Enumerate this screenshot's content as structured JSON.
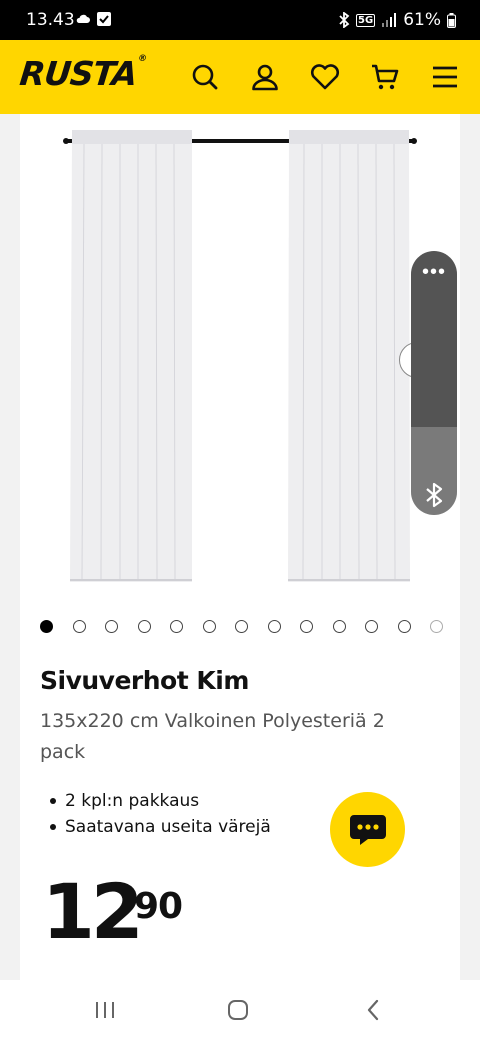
{
  "status_bar": {
    "time": "13.43",
    "battery": "61%",
    "network": "5G",
    "icons": [
      "cloud-icon",
      "check-box-icon",
      "bluetooth-icon",
      "signal-icon",
      "battery-icon"
    ]
  },
  "header": {
    "logo": "RUSTA",
    "logo_mark": "®",
    "background": "#ffd600",
    "icons": [
      "search-icon",
      "user-icon",
      "heart-icon",
      "cart-icon",
      "menu-icon"
    ]
  },
  "gallery": {
    "image": "curtain-pair-image",
    "dot_count": 13,
    "active_index": 0
  },
  "product": {
    "title": "Sivuverhot Kim",
    "subtitle": "135x220 cm Valkoinen Polyesteriä 2 pack",
    "features": [
      "2 kpl:n pakkaus",
      "Saatavana useita värejä"
    ],
    "price_int": "12",
    "price_dec": "90"
  },
  "chat": {
    "icon": "chat-icon"
  },
  "side_panel": {
    "icons": [
      "more-icon",
      "bluetooth-icon"
    ]
  },
  "nav_bar": {
    "icons": [
      "recent-apps-icon",
      "home-icon",
      "back-icon"
    ]
  }
}
